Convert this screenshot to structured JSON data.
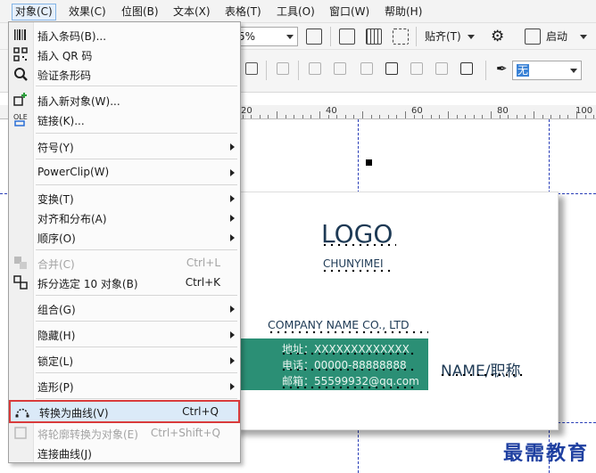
{
  "menubar": {
    "items": [
      {
        "label": "对象(C)",
        "active": true
      },
      {
        "label": "效果(C)"
      },
      {
        "label": "位图(B)"
      },
      {
        "label": "文本(X)"
      },
      {
        "label": "表格(T)"
      },
      {
        "label": "工具(O)"
      },
      {
        "label": "窗口(W)"
      },
      {
        "label": "帮助(H)"
      }
    ]
  },
  "toolbar": {
    "zoom_value": "5%",
    "snap_label": "贴齐(T)",
    "launch_label": "启动",
    "outline_value": "无"
  },
  "ruler": {
    "labels": [
      "20",
      "40",
      "60",
      "80",
      "100"
    ]
  },
  "card": {
    "logo": "LOGO",
    "sub": "CHUNYIMEI",
    "company": "COMPANY NAME CO., LTD",
    "address": "地址：XXXXXXXXXXXXX",
    "phone": "电话：00000-88888888",
    "email": "邮箱：55599932@qq.com",
    "name": "NAME/职称"
  },
  "menu": {
    "items": [
      {
        "label": "插入条码(B)...",
        "icon": "barcode-icon"
      },
      {
        "label": "插入 QR 码",
        "icon": "qr-code-icon"
      },
      {
        "label": "验证条形码",
        "icon": "verify-barcode-icon"
      },
      {
        "label": "插入新对象(W)...",
        "icon": "insert-object-icon"
      },
      {
        "label": "链接(K)...",
        "icon": "ole-icon"
      },
      {
        "label": "符号(Y)",
        "submenu": true
      },
      {
        "label": "PowerClip(W)",
        "submenu": true
      },
      {
        "label": "变换(T)",
        "submenu": true
      },
      {
        "label": "对齐和分布(A)",
        "submenu": true
      },
      {
        "label": "顺序(O)",
        "submenu": true
      },
      {
        "label": "合并(C)",
        "shortcut": "Ctrl+L",
        "disabled": true,
        "icon": "combine-icon"
      },
      {
        "label": "拆分选定 10 对象(B)",
        "shortcut": "Ctrl+K",
        "icon": "break-apart-icon"
      },
      {
        "label": "组合(G)",
        "submenu": true
      },
      {
        "label": "隐藏(H)",
        "submenu": true
      },
      {
        "label": "锁定(L)",
        "submenu": true
      },
      {
        "label": "造形(P)",
        "submenu": true
      },
      {
        "label": "转换为曲线(V)",
        "shortcut": "Ctrl+Q",
        "highlighted": true,
        "icon": "convert-to-curves-icon"
      },
      {
        "label": "将轮廓转换为对象(E)",
        "shortcut": "Ctrl+Shift+Q",
        "disabled": true,
        "icon": "outline-to-object-icon"
      },
      {
        "label": "连接曲线(J)"
      }
    ]
  },
  "watermark": "最需教育",
  "colors": {
    "accent_teal": "#2b8f75",
    "highlight_border": "#d93b3b",
    "guide": "#2a3fb8"
  }
}
